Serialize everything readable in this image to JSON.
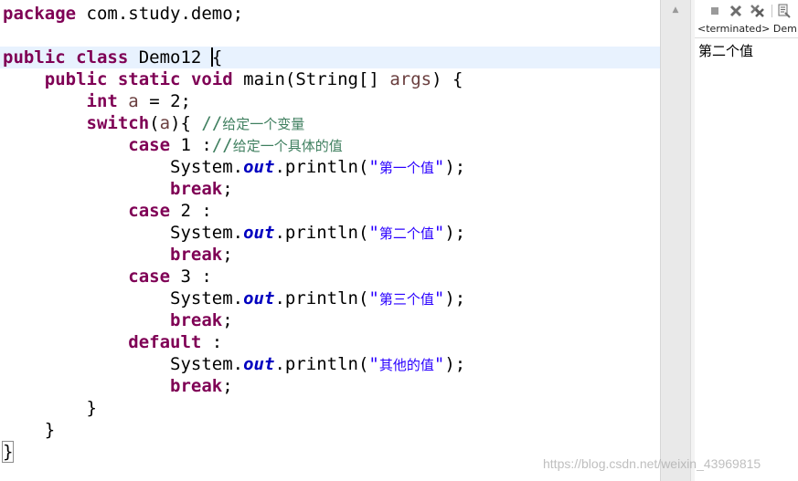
{
  "editor": {
    "package_kw": "package",
    "package_name": " com.study.demo;",
    "public_kw": "public",
    "class_kw": "class",
    "class_name": " Demo12 ",
    "open_brace": "{",
    "static_kw": "static",
    "void_kw": "void",
    "main_sig_1": " main(String[] ",
    "args": "args",
    "main_sig_2": ") {",
    "int_kw": "int",
    "a_var": "a",
    "int_rest": " = 2;",
    "switch_word": "switch",
    "switch_open": "(",
    "switch_close": "){ ",
    "comment_slashes": "//",
    "comment_variable": "给定一个变量",
    "case_kw": "case",
    "case1_rest": " 1 :",
    "comment_specific": "给定一个具体的值",
    "system_out": "System.",
    "out_field": "out",
    "println_open": ".println(",
    "quote": "\"",
    "println_close": ");",
    "str_first": "第一个值",
    "str_second": "第二个值",
    "str_third": "第三个值",
    "str_other": "其他的值",
    "break_kw": "break",
    "semicolon": ";",
    "case2_rest": " 2 :",
    "case3_rest": " 3 :",
    "default_kw": "default",
    "default_rest": " :",
    "close_brace": "}"
  },
  "console": {
    "title": "<terminated> Dem",
    "output": "第二个值",
    "toolbar": {
      "terminate_icon": "terminate-icon",
      "remove_launch_icon": "remove-launch-icon",
      "remove_all_icon": "remove-all-terminated-icon",
      "clear_console_icon": "clear-console-icon"
    }
  },
  "watermark": "https://blog.csdn.net/weixin_43969815",
  "colors": {
    "keyword": "#7f0055",
    "string": "#2a00ff",
    "comment": "#3f7f5f",
    "field": "#0000c0",
    "local_variable": "#6a3e3e",
    "current_line": "#e8f2fe"
  }
}
